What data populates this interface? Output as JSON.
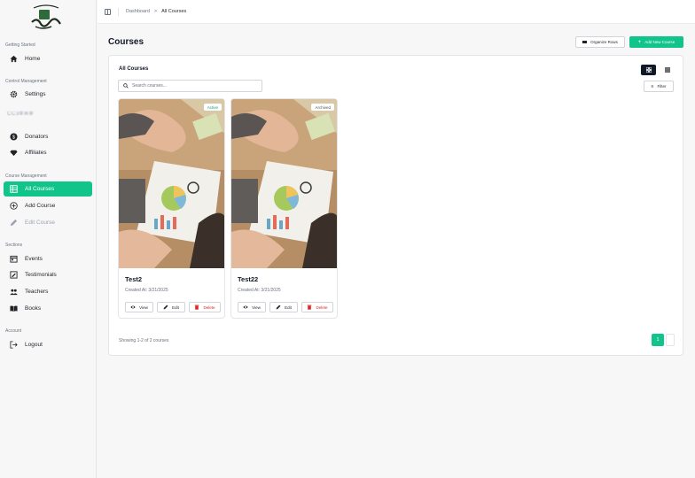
{
  "sidebar": {
    "sections": {
      "getting_started": "Getting Started",
      "control": "Control Management",
      "course": "Course Management",
      "sections": "Sections",
      "account": "Account"
    },
    "items": {
      "home": "Home",
      "settings": "Settings",
      "blurred": "ССЗФЖФ",
      "donators": "Donators",
      "affiliates": "Affiliates",
      "all_courses": "All Courses",
      "add_course": "Add Course",
      "edit_course": "Edit Course",
      "events": "Events",
      "testimonials": "Testimonials",
      "teachers": "Teachers",
      "books": "Books",
      "logout": "Logout"
    }
  },
  "breadcrumb": {
    "dashboard": "Dashboard",
    "separator": ">",
    "current": "All Courses"
  },
  "page": {
    "title": "Courses",
    "organize_label": "Organize Rows",
    "new_course_label": "Add New Course"
  },
  "panel": {
    "title": "All Courses",
    "search_placeholder": "Search courses...",
    "filter_label": "Filter",
    "showing": "Showing 1-2 of 2 courses",
    "current_page": "1"
  },
  "courses": [
    {
      "name": "Test2",
      "created": "Created At: 3/21/2025",
      "status": "Active"
    },
    {
      "name": "Test22",
      "created": "Created At: 3/21/2025",
      "status": "Archived"
    }
  ],
  "actions": {
    "view": "View",
    "edit": "Edit",
    "delete": "Delete"
  },
  "colors": {
    "accent": "#10c48a",
    "danger": "#dc2626"
  }
}
